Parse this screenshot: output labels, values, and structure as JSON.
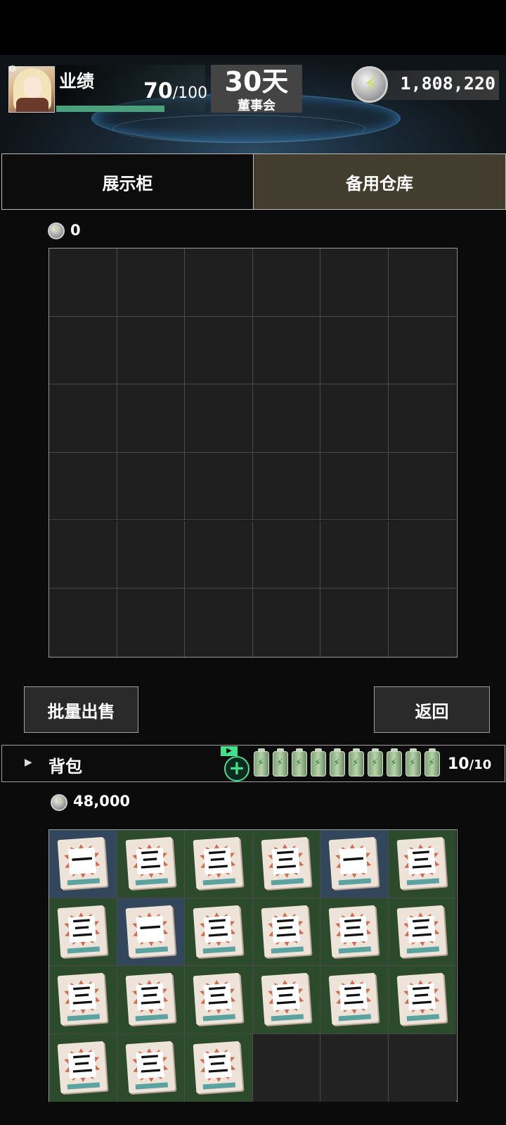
{
  "header": {
    "perf_label": "业绩",
    "perf_current": "70",
    "perf_max": "/100",
    "perf_progress": 0.7,
    "days_value": "30天",
    "days_label": "董事会",
    "coins": "1,808,220"
  },
  "tabs": [
    {
      "label": "展示柜",
      "active": false
    },
    {
      "label": "备用仓库",
      "active": true
    }
  ],
  "storage": {
    "value": "0"
  },
  "buttons": {
    "sell": "批量出售",
    "back": "返回"
  },
  "bag": {
    "title": "背包",
    "ad_tag": "▶",
    "count": "10",
    "max": "/10",
    "value": "48,000",
    "items": [
      {
        "num": "一",
        "tone": "blue"
      },
      {
        "num": "三",
        "tone": "green"
      },
      {
        "num": "三",
        "tone": "green"
      },
      {
        "num": "三",
        "tone": "green"
      },
      {
        "num": "一",
        "tone": "blue"
      },
      {
        "num": "三",
        "tone": "green"
      },
      {
        "num": "三",
        "tone": "green"
      },
      {
        "num": "一",
        "tone": "blue"
      },
      {
        "num": "三",
        "tone": "green"
      },
      {
        "num": "三",
        "tone": "green"
      },
      {
        "num": "三",
        "tone": "green"
      },
      {
        "num": "三",
        "tone": "green"
      },
      {
        "num": "三",
        "tone": "green"
      },
      {
        "num": "三",
        "tone": "green"
      },
      {
        "num": "三",
        "tone": "green"
      },
      {
        "num": "三",
        "tone": "green"
      },
      {
        "num": "三",
        "tone": "green"
      },
      {
        "num": "三",
        "tone": "green"
      },
      {
        "num": "三",
        "tone": "green"
      },
      {
        "num": "三",
        "tone": "green"
      },
      {
        "num": "三",
        "tone": "green"
      }
    ]
  },
  "colors": {
    "accent_green": "#43e08b",
    "tab_active": "#433d2f",
    "perf_bar": "#4aa07c"
  }
}
